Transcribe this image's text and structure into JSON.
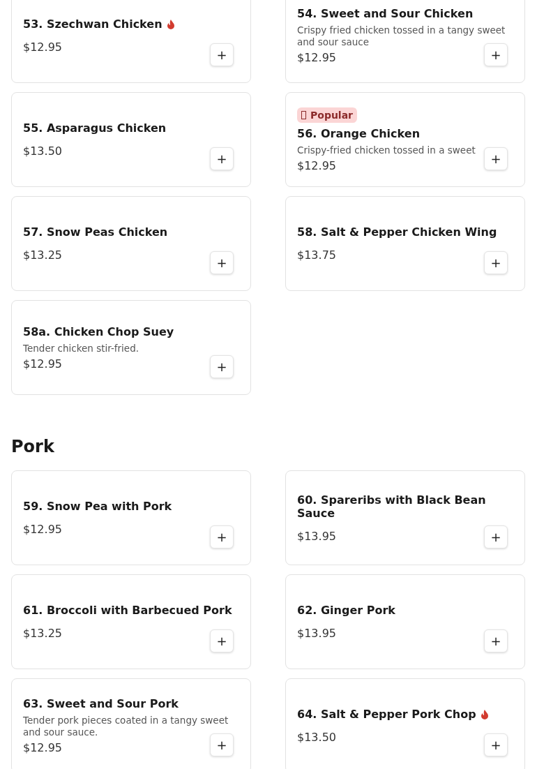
{
  "sections": [
    {
      "items": [
        {
          "name": "53. Szechwan Chicken",
          "spicy": true,
          "price": "$12.95",
          "add": "+"
        },
        {
          "name": "55. Asparagus Chicken",
          "price": "$13.50",
          "add": "+"
        },
        {
          "name": "57. Snow Peas Chicken",
          "price": "$13.25",
          "add": "+"
        },
        {
          "name": "58a. Chicken Chop Suey",
          "description": "Tender chicken stir-fried.",
          "price": "$12.95",
          "add": "+"
        },
        {
          "name": "54. Sweet and Sour Chicken",
          "description": "Crispy fried chicken tossed in a tangy sweet and sour sauce",
          "price": "$12.95",
          "add": "+"
        },
        {
          "badge": "Popular",
          "name": "56. Orange Chicken",
          "description": "Crispy-fried chicken tossed in a sweet",
          "price": "$12.95",
          "add": "+"
        },
        {
          "name": "58. Salt & Pepper Chicken Wing",
          "price": "$13.75",
          "add": "+"
        }
      ]
    },
    {
      "title": "Pork",
      "items": [
        {
          "name": "59. Snow Pea with Pork",
          "price": "$12.95",
          "add": "+"
        },
        {
          "name": "61. Broccoli with Barbecued Pork",
          "price": "$13.25",
          "add": "+"
        },
        {
          "name": "63. Sweet and Sour Pork",
          "description": "Tender pork pieces coated in a tangy sweet and sour sauce.",
          "price": "$12.95",
          "add": "+"
        },
        {
          "name": "60. Spareribs with Black Bean Sauce",
          "price": "$13.95",
          "add": "+"
        },
        {
          "name": "62. Ginger Pork",
          "price": "$13.95",
          "add": "+"
        },
        {
          "name": "64. Salt & Pepper Pork Chop",
          "spicy": true,
          "price": "$13.50",
          "add": "+"
        }
      ]
    }
  ]
}
